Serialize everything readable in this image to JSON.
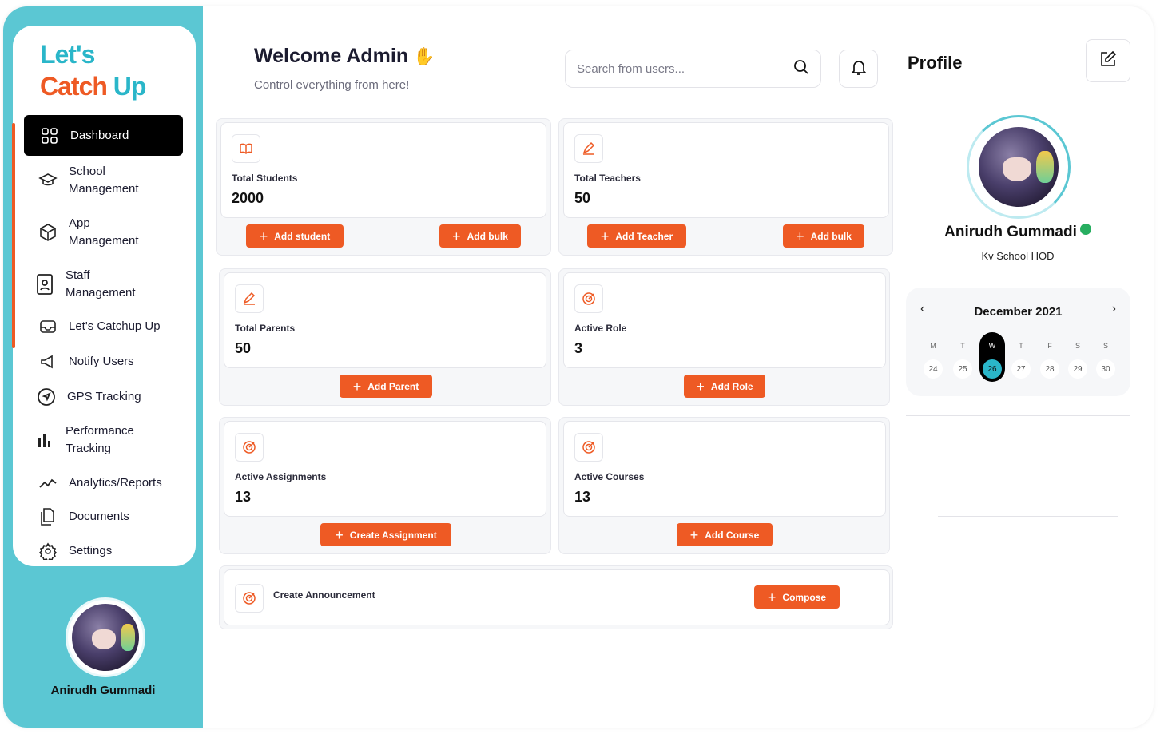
{
  "logo": {
    "line1": "Let's",
    "line2_a": "Catch ",
    "line2_b": "Up"
  },
  "nav": [
    {
      "label": "Dashboard",
      "icon": "grid-icon"
    },
    {
      "label_1": "School",
      "label_2": "Management",
      "icon": "graduation-cap-icon"
    },
    {
      "label_1": "App",
      "label_2": "Management",
      "icon": "box-icon"
    },
    {
      "label_1": "Staff",
      "label_2": "Management",
      "icon": "id-badge-icon"
    },
    {
      "label": "Let's Catchup Up",
      "icon": "inbox-icon"
    },
    {
      "label": "Notify Users",
      "icon": "megaphone-icon"
    },
    {
      "label": "GPS Tracking",
      "icon": "navigation-icon"
    },
    {
      "label_1": "Performance",
      "label_2": "Tracking",
      "icon": "bar-chart-icon"
    },
    {
      "label": "Analytics/Reports",
      "icon": "trend-line-icon"
    },
    {
      "label": "Documents",
      "icon": "documents-icon"
    },
    {
      "label": "Settings",
      "icon": "gear-icon"
    }
  ],
  "sidebar_user": {
    "name": "Anirudh Gummadi"
  },
  "header": {
    "title": "Welcome Admin",
    "subtitle": "Control everything from here!",
    "search_placeholder": "Search from users..."
  },
  "stats": {
    "students": {
      "title": "Total Students",
      "value": "2000",
      "btn1": "Add student",
      "btn2": "Add bulk"
    },
    "teachers": {
      "title": "Total Teachers",
      "value": "50",
      "btn1": "Add Teacher",
      "btn2": "Add bulk"
    },
    "parents": {
      "title": "Total Parents",
      "value": "50",
      "btn": "Add Parent"
    },
    "roles": {
      "title": "Active Role",
      "value": "3",
      "btn": "Add Role"
    },
    "assignments": {
      "title": "Active Assignments",
      "value": "13",
      "btn": "Create Assignment"
    },
    "courses": {
      "title": "Active Courses",
      "value": "13",
      "btn": "Add Course"
    },
    "announcement": {
      "title": "Create Announcement",
      "btn": "Compose"
    }
  },
  "profile": {
    "title": "Profile",
    "name": "Anirudh Gummadi",
    "role": "Kv School HOD"
  },
  "calendar": {
    "month": "December 2021",
    "day_names": [
      "M",
      "T",
      "W",
      "T",
      "F",
      "S",
      "S"
    ],
    "days": [
      "24",
      "25",
      "26",
      "27",
      "28",
      "29",
      "30"
    ],
    "selected": "26"
  },
  "colors": {
    "accent": "#ee5a24",
    "teal": "#5bc7d3",
    "dark": "#000000"
  }
}
